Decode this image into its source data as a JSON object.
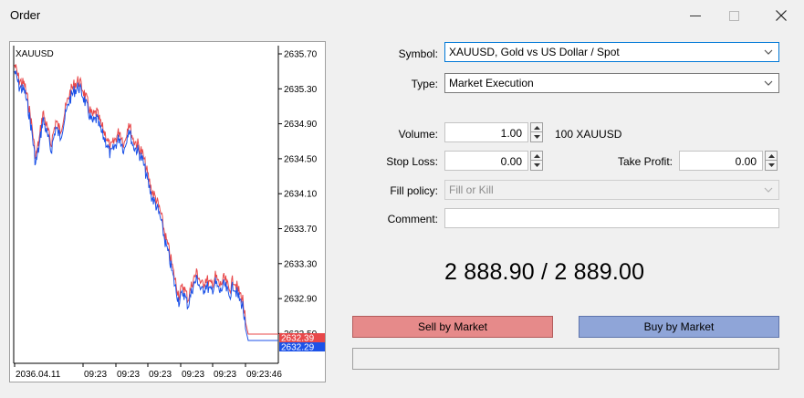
{
  "window": {
    "title": "Order"
  },
  "chart": {
    "symbol": "XAUUSD",
    "price_ticks": [
      "2635.70",
      "2635.30",
      "2634.90",
      "2634.50",
      "2634.10",
      "2633.70",
      "2633.30",
      "2632.90",
      "2632.50"
    ],
    "ask_tag": "2632.39",
    "bid_tag": "2632.29",
    "time_ticks": [
      "2036.04.11",
      "09:23",
      "09:23",
      "09:23",
      "09:23",
      "09:23",
      "09:23:46"
    ],
    "colors": {
      "ask": "#e8484a",
      "bid": "#1c52e8"
    }
  },
  "form": {
    "symbol_label": "Symbol:",
    "symbol_value": "XAUUSD, Gold vs US Dollar / Spot",
    "type_label": "Type:",
    "type_value": "Market Execution",
    "volume_label": "Volume:",
    "volume_value": "1.00",
    "volume_unit": "100 XAUUSD",
    "stop_loss_label": "Stop Loss:",
    "stop_loss_value": "0.00",
    "take_profit_label": "Take Profit:",
    "take_profit_value": "0.00",
    "fill_policy_label": "Fill policy:",
    "fill_policy_value": "Fill or Kill",
    "comment_label": "Comment:",
    "comment_value": ""
  },
  "quote": {
    "text": "2 888.90 / 2 889.00"
  },
  "buttons": {
    "sell": "Sell by Market",
    "buy": "Buy by Market"
  }
}
